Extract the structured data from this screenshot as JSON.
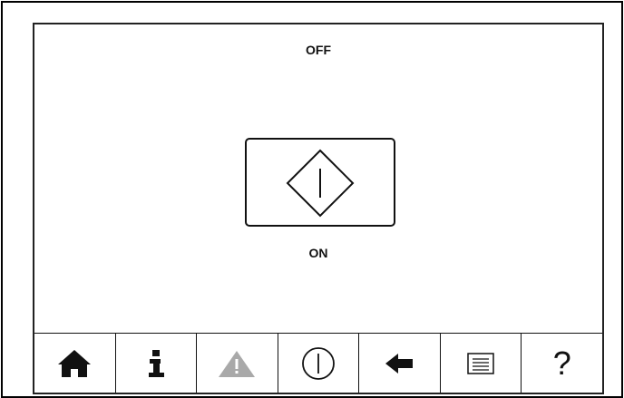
{
  "status": {
    "text": "OFF"
  },
  "power": {
    "label": "ON"
  },
  "toolbar": {
    "items": [
      {
        "icon": "home-icon"
      },
      {
        "icon": "info-icon"
      },
      {
        "icon": "warning-icon",
        "color": "#a9a9a9"
      },
      {
        "icon": "power-icon"
      },
      {
        "icon": "back-arrow-icon"
      },
      {
        "icon": "list-icon"
      },
      {
        "icon": "help-icon",
        "text": "?"
      }
    ]
  }
}
